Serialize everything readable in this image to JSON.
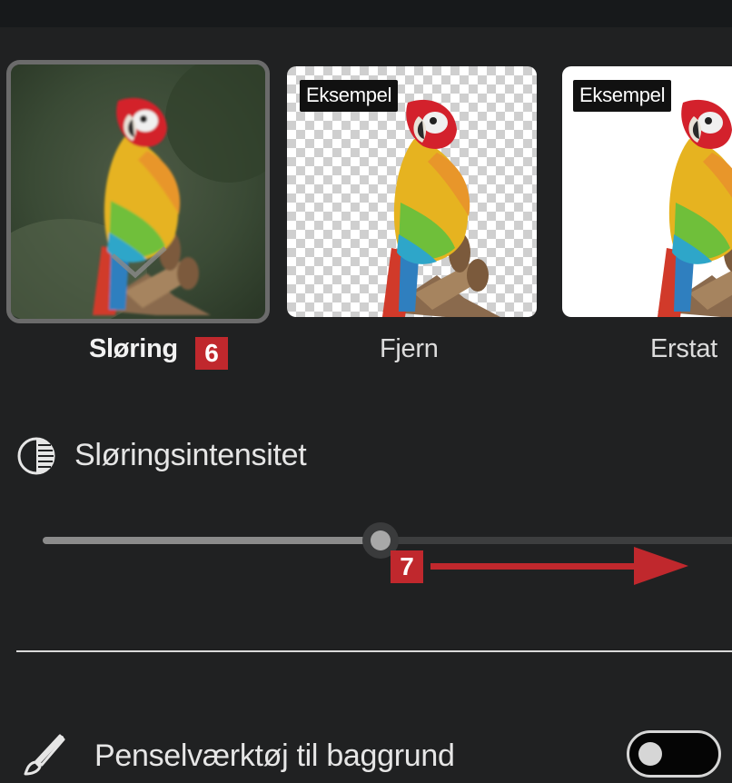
{
  "options": [
    {
      "label": "Sløring",
      "callout": "6",
      "selected": true
    },
    {
      "label": "Fjern",
      "badge": "Eksempel"
    },
    {
      "label": "Erstat",
      "badge": "Eksempel"
    }
  ],
  "blur_intensity": {
    "label": "Sløringsintensitet",
    "icon": "contrast-half-circle-icon",
    "callout": "7",
    "value_fraction": 0.5
  },
  "brush_tool": {
    "label": "Penselværktøj til baggrund",
    "icon": "paintbrush-icon",
    "enabled": false
  },
  "colors": {
    "background": "#202122",
    "callout": "#c0282d",
    "arrow": "#c0282d"
  }
}
